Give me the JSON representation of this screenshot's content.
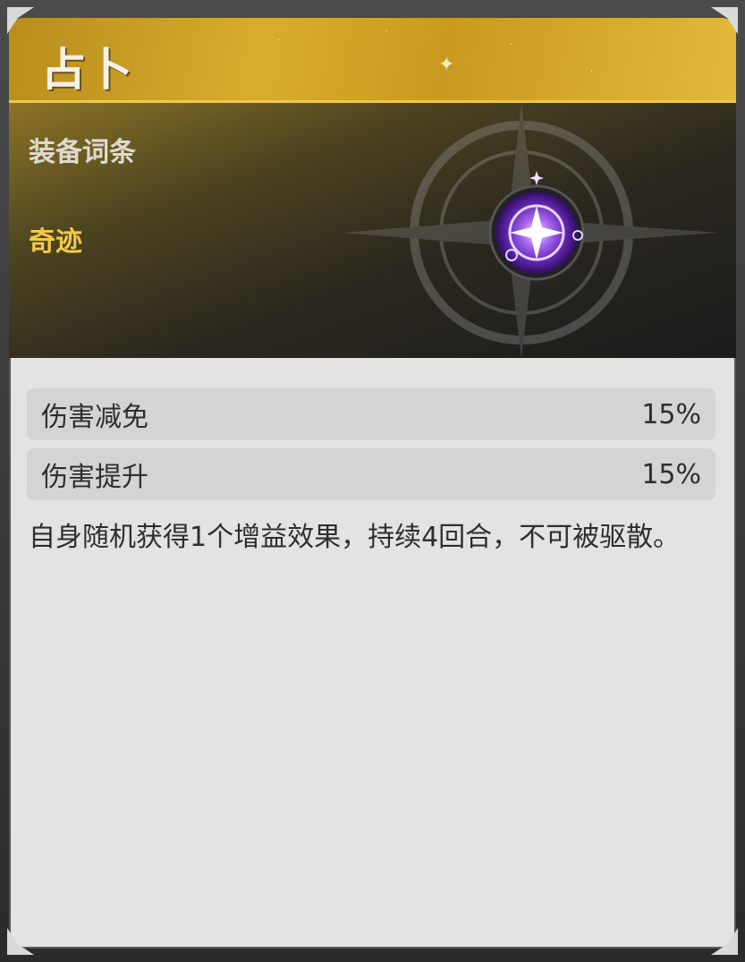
{
  "card": {
    "title": "占卜",
    "subtitle": "装备词条",
    "affix_name": "奇迹",
    "icon": "star-orb-icon"
  },
  "stats": [
    {
      "label": "伤害减免",
      "value": "15%"
    },
    {
      "label": "伤害提升",
      "value": "15%"
    }
  ],
  "description": "自身随机获得1个增益效果，持续4回合，不可被驱散。",
  "colors": {
    "header_gold": "#d9ad2c",
    "affix_gold": "#f2c94a",
    "body_bg": "#e3e3e3",
    "row_bg": "#d4d4d4",
    "orb_purple": "#7b3fd0"
  }
}
